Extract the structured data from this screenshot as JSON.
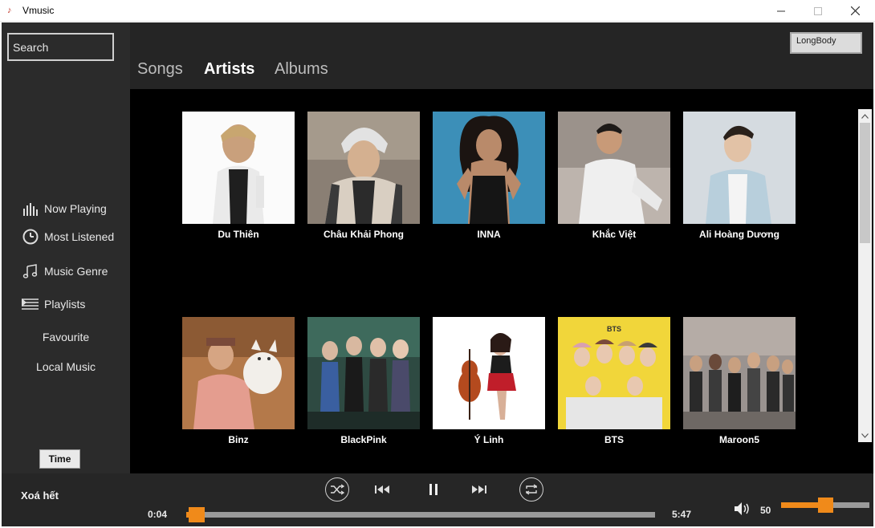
{
  "window": {
    "title": "Vmusic"
  },
  "sidebar": {
    "search_placeholder": "Search",
    "items": [
      {
        "label": "Now Playing",
        "icon": "bars-chart-icon"
      },
      {
        "label": "Most Listened",
        "icon": "clock-icon"
      },
      {
        "label": "Music Genre",
        "icon": "music-note-icon"
      },
      {
        "label": "Playlists",
        "icon": "playlist-icon"
      },
      {
        "label": "Favourite"
      },
      {
        "label": "Local Music"
      }
    ],
    "time_label": "Time"
  },
  "header": {
    "tabs": [
      {
        "label": "Songs",
        "active": false
      },
      {
        "label": "Artists",
        "active": true
      },
      {
        "label": "Albums",
        "active": false
      }
    ],
    "user_label": "LongBody"
  },
  "artists": [
    {
      "name": "Du Thiên"
    },
    {
      "name": "Châu Khải Phong"
    },
    {
      "name": "INNA"
    },
    {
      "name": "Khắc Việt"
    },
    {
      "name": "Ali Hoàng Dương"
    },
    {
      "name": "Binz"
    },
    {
      "name": "BlackPink"
    },
    {
      "name": "Ý Linh"
    },
    {
      "name": "BTS"
    },
    {
      "name": "Maroon5"
    }
  ],
  "player": {
    "clear_label": "Xoá hết",
    "current_time": "0:04",
    "total_time": "5:47",
    "progress_fraction": 0.012,
    "volume": "50",
    "volume_fraction": 0.5,
    "accent_color": "#f08a1a"
  }
}
